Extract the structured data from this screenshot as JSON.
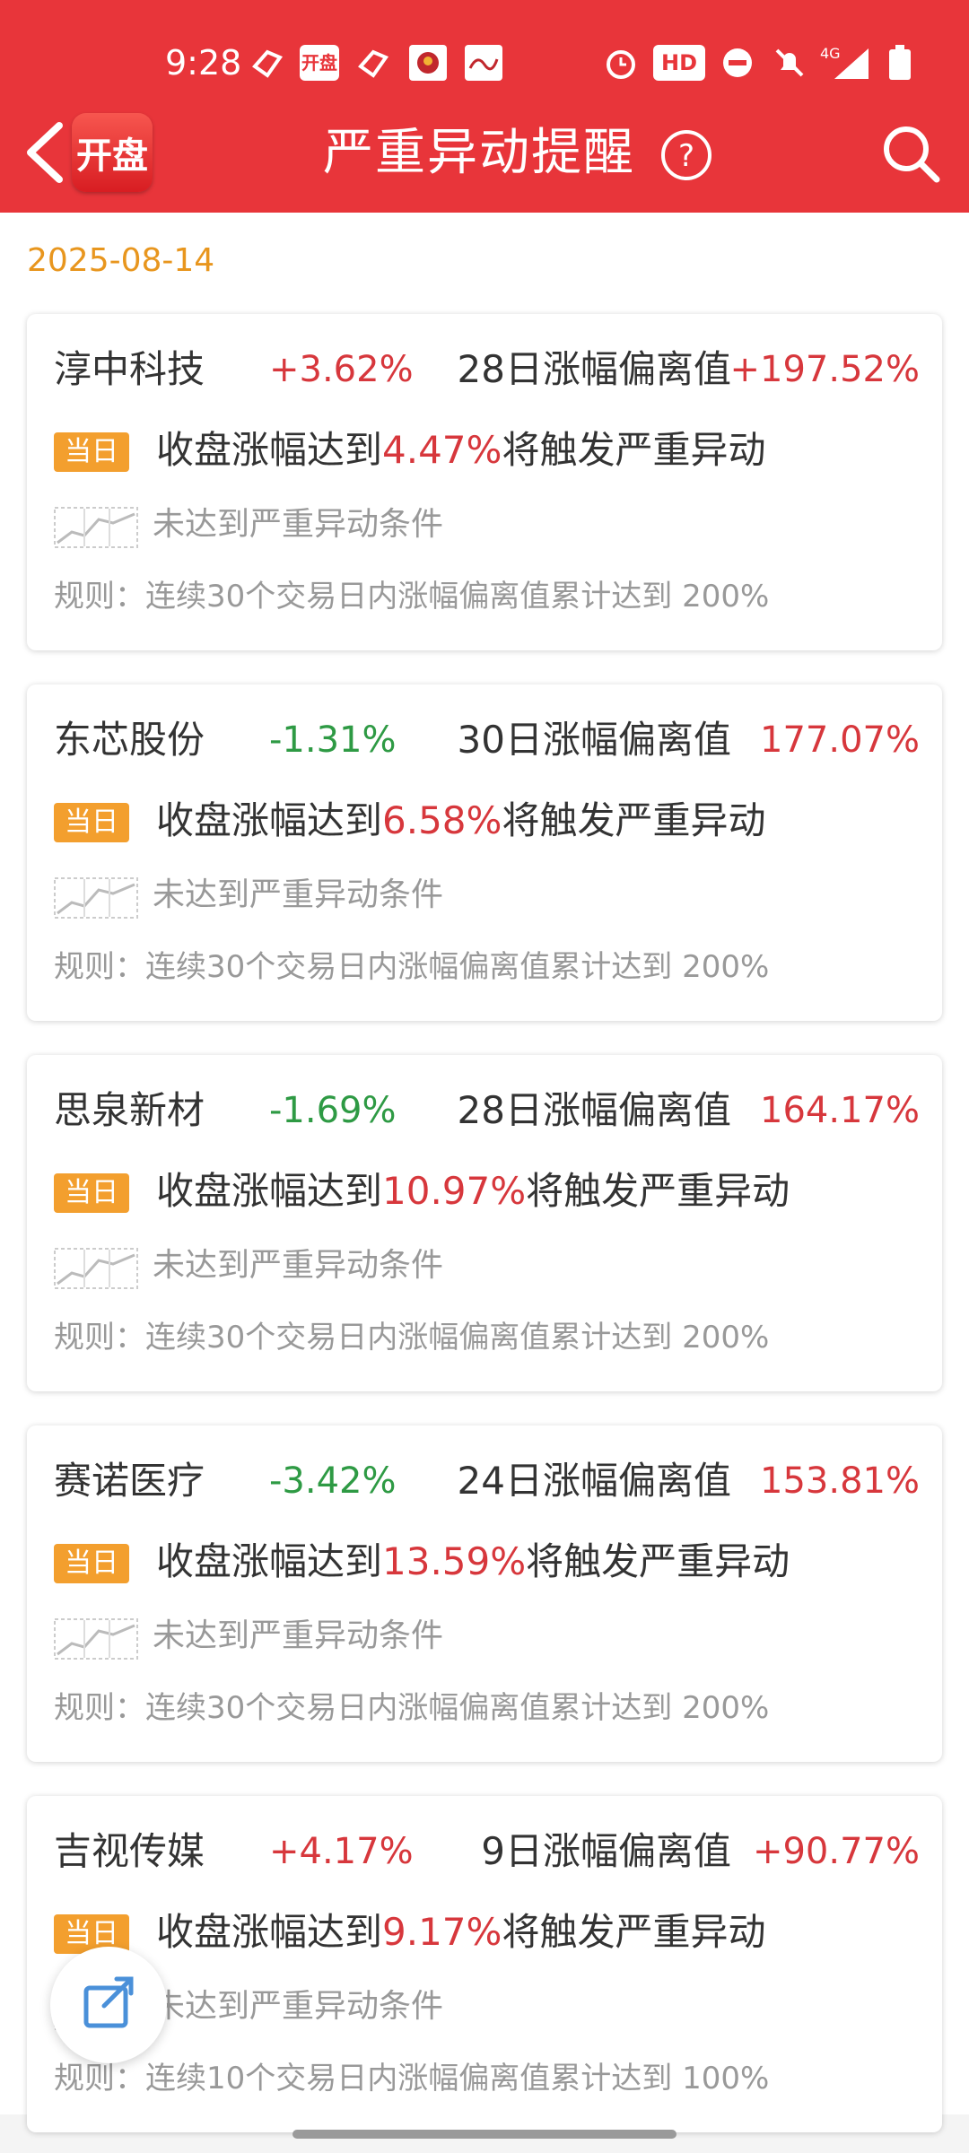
{
  "status_bar": {
    "time": "9:28",
    "network": "4G"
  },
  "header": {
    "back_icon": "chevron-left-icon",
    "logo_text": "开盘",
    "title": "严重异动提醒",
    "help_icon": "question-circle-icon",
    "search_icon": "search-icon",
    "bg_color": "#e8353a"
  },
  "date": "2025-08-14",
  "cards": [
    {
      "name": "淳中科技",
      "change": "+3.62%",
      "change_dir": "up",
      "deviation_label": "28日涨幅偏离值",
      "deviation_value": "+197.52%",
      "tag": "当日",
      "trigger_prefix": "收盘涨幅达到",
      "trigger_pct": "4.47%",
      "trigger_suffix": "将触发严重异动",
      "condition": "未达到严重异动条件",
      "rule": "规则：连续30个交易日内涨幅偏离值累计达到 200%"
    },
    {
      "name": "东芯股份",
      "change": "-1.31%",
      "change_dir": "down",
      "deviation_label": "30日涨幅偏离值",
      "deviation_value": "177.07%",
      "tag": "当日",
      "trigger_prefix": "收盘涨幅达到",
      "trigger_pct": "6.58%",
      "trigger_suffix": "将触发严重异动",
      "condition": "未达到严重异动条件",
      "rule": "规则：连续30个交易日内涨幅偏离值累计达到 200%"
    },
    {
      "name": "思泉新材",
      "change": "-1.69%",
      "change_dir": "down",
      "deviation_label": "28日涨幅偏离值",
      "deviation_value": "164.17%",
      "tag": "当日",
      "trigger_prefix": "收盘涨幅达到",
      "trigger_pct": "10.97%",
      "trigger_suffix": "将触发严重异动",
      "condition": "未达到严重异动条件",
      "rule": "规则：连续30个交易日内涨幅偏离值累计达到 200%"
    },
    {
      "name": "赛诺医疗",
      "change": "-3.42%",
      "change_dir": "down",
      "deviation_label": "24日涨幅偏离值",
      "deviation_value": "153.81%",
      "tag": "当日",
      "trigger_prefix": "收盘涨幅达到",
      "trigger_pct": "13.59%",
      "trigger_suffix": "将触发严重异动",
      "condition": "未达到严重异动条件",
      "rule": "规则：连续30个交易日内涨幅偏离值累计达到 200%"
    },
    {
      "name": "吉视传媒",
      "change": "+4.17%",
      "change_dir": "up",
      "deviation_label": "9日涨幅偏离值",
      "deviation_value": "+90.77%",
      "tag": "当日",
      "trigger_prefix": "收盘涨幅达到",
      "trigger_pct": "9.17%",
      "trigger_suffix": "将触发严重异动",
      "condition": "未达到严重异动条件",
      "rule": "规则：连续10个交易日内涨幅偏离值累计达到 100%"
    }
  ],
  "fab_icon": "share-edit-icon",
  "colors": {
    "up": "#d7373c",
    "down": "#2e9a44",
    "tag": "#f39f2e",
    "date": "#e8961e"
  }
}
